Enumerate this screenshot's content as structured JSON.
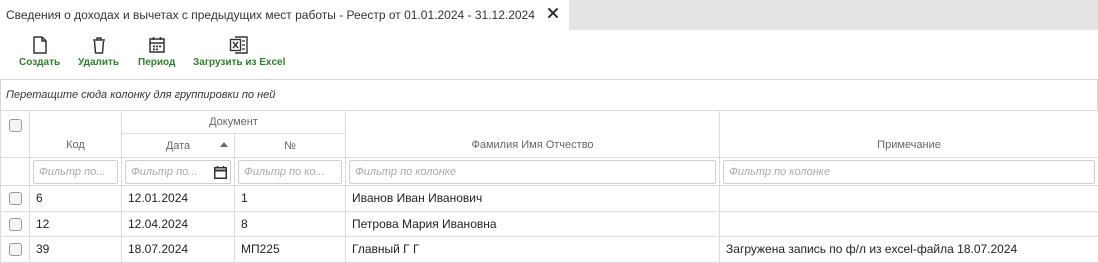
{
  "tab": {
    "title": "Сведения о доходах и вычетах с предыдущих мест работы - Реестр от 01.01.2024 - 31.12.2024"
  },
  "toolbar": {
    "create_label": "Создать",
    "delete_label": "Удалить",
    "period_label": "Период",
    "import_excel_label": "Загрузить из Excel"
  },
  "grid": {
    "group_panel_text": "Перетащите сюда колонку для группировки по ней",
    "headers": {
      "code": "Код",
      "document": "Документ",
      "date": "Дата",
      "number": "№",
      "fio": "Фамилия Имя Отчество",
      "note": "Примечание"
    },
    "filters": {
      "code_placeholder": "Фильтр по...",
      "date_placeholder": "Фильтр по...",
      "number_placeholder": "Фильтр по ко...",
      "fio_placeholder": "Фильтр по колонке",
      "note_placeholder": "Фильтр по колонке"
    },
    "rows": [
      {
        "code": "6",
        "date": "12.01.2024",
        "number": "1",
        "fio": "Иванов Иван Иванович",
        "note": ""
      },
      {
        "code": "12",
        "date": "12.04.2024",
        "number": "8",
        "fio": "Петрова Мария Ивановна",
        "note": ""
      },
      {
        "code": "39",
        "date": "18.07.2024",
        "number": "МП225",
        "fio": "Главный Г Г",
        "note": "Загружена запись по ф/л из excel-файла 18.07.2024"
      }
    ]
  },
  "colors": {
    "accent_green": "#2f7d31",
    "tabstrip_bg": "#e4e4e4"
  }
}
